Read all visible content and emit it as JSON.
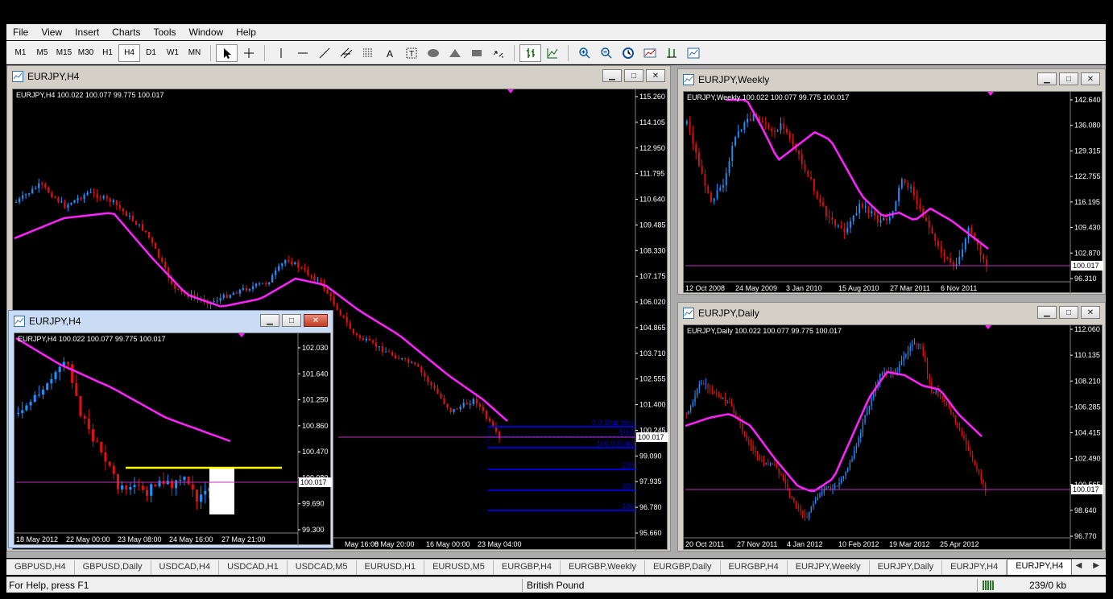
{
  "menu": [
    "File",
    "View",
    "Insert",
    "Charts",
    "Tools",
    "Window",
    "Help"
  ],
  "timeframes": [
    "M1",
    "M5",
    "M15",
    "M30",
    "H1",
    "H4",
    "D1",
    "W1",
    "MN"
  ],
  "active_timeframe": "H4",
  "windows": {
    "main_h4": {
      "title": "EURJPY,H4",
      "info": "EURJPY,H4  100.022 100.077 99.775 100.017",
      "price_labels": [
        "115.260",
        "114.105",
        "112.950",
        "111.795",
        "110.640",
        "109.485",
        "108.330",
        "107.175",
        "106.020",
        "104.865",
        "103.710",
        "102.555",
        "101.400",
        "100.245",
        "99.090",
        "97.935",
        "96.780",
        "95.660"
      ],
      "current_price": "100.017",
      "date_labels": [
        "May 16:00",
        "8 May 20:00",
        "16 May 00:00",
        "23 May 04:00"
      ],
      "fib_labels": [
        "0.0 Stop loss",
        "50.0",
        "100.0 Entry",
        "200",
        "300",
        "400"
      ]
    },
    "small_h4": {
      "title": "EURJPY,H4",
      "info": "EURJPY,H4  100.022 100.077 99.775 100.017",
      "price_labels": [
        "102.030",
        "101.640",
        "101.250",
        "100.860",
        "100.470",
        "100.080",
        "99.690",
        "99.300"
      ],
      "current_price": "100.017",
      "date_labels": [
        "18 May 2012",
        "22 May 00:00",
        "23 May 08:00",
        "24 May 16:00",
        "27 May 21:00"
      ]
    },
    "weekly": {
      "title": "EURJPY,Weekly",
      "info": "EURJPY,Weekly  100.022 100.077 99.775 100.017",
      "price_labels": [
        "142.640",
        "136.080",
        "129.315",
        "122.755",
        "116.195",
        "109.430",
        "102.870",
        "96.310"
      ],
      "current_price": "100.017",
      "date_labels": [
        "12 Oct 2008",
        "24 May 2009",
        "3 Jan 2010",
        "15 Aug 2010",
        "27 Mar 2011",
        "6 Nov 2011"
      ]
    },
    "daily": {
      "title": "EURJPY,Daily",
      "info": "EURJPY,Daily  100.022 100.077 99.775 100.017",
      "price_labels": [
        "112.060",
        "110.135",
        "108.210",
        "106.285",
        "104.415",
        "102.490",
        "100.565",
        "98.640",
        "96.770"
      ],
      "current_price": "100.017",
      "date_labels": [
        "20 Oct 2011",
        "27 Nov 2011",
        "4 Jan 2012",
        "10 Feb 2012",
        "19 Mar 2012",
        "25 Apr 2012"
      ]
    }
  },
  "tabs": [
    "GBPUSD,H4",
    "GBPUSD,Daily",
    "USDCAD,H4",
    "USDCAD,H1",
    "USDCAD,M5",
    "EURUSD,H1",
    "EURUSD,M5",
    "EURGBP,H4",
    "EURGBP,Weekly",
    "EURGBP,Daily",
    "EURGBP,H4",
    "EURJPY,Weekly",
    "EURJPY,Daily",
    "EURJPY,H4",
    "EURJPY,H4"
  ],
  "active_tab_index": 14,
  "status": {
    "help": "For Help, press F1",
    "profile": "British Pound",
    "traffic": "239/0 kb"
  },
  "colors": {
    "bull": "#1e90ff",
    "bear": "#e01010",
    "ma": "#ff22ff",
    "price_line": "#c030c0",
    "fib": "#0000cc",
    "entry_line": "#ffff00"
  }
}
